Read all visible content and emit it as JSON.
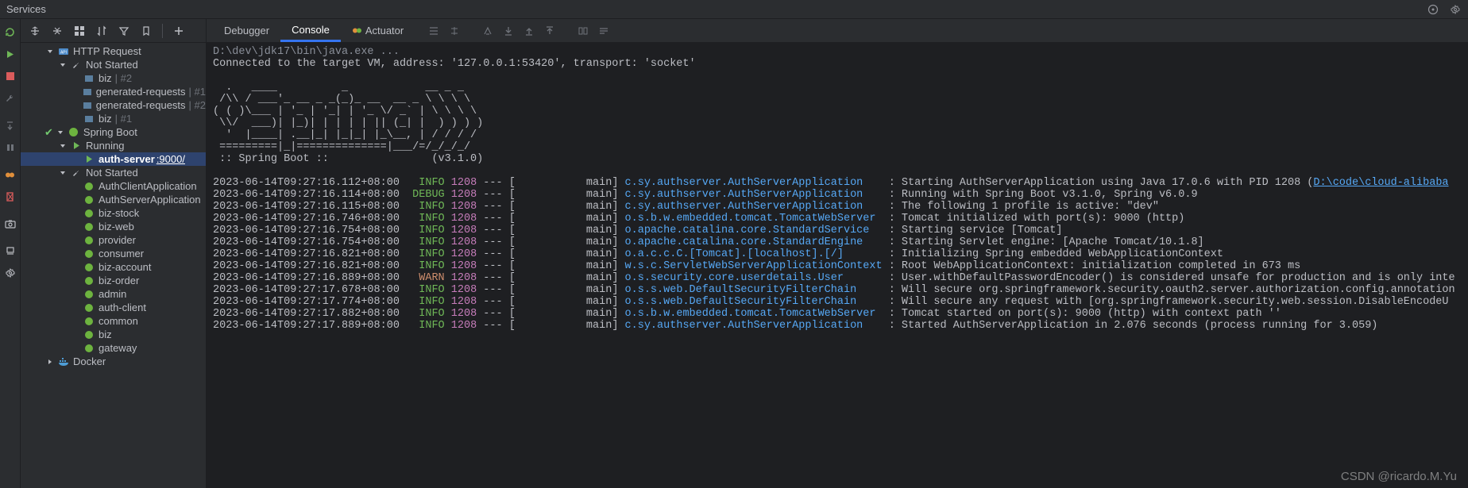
{
  "titlebar": {
    "title": "Services"
  },
  "tabs": {
    "debugger": "Debugger",
    "console": "Console",
    "actuator": "Actuator"
  },
  "tree": {
    "http_request": "HTTP Request",
    "not_started_1": "Not Started",
    "biz_2": "biz",
    "biz_2_sub": " | #2",
    "gen_req_1": "generated-requests",
    "gen_req_1_sub": " | #1",
    "gen_req_2": "generated-requests",
    "gen_req_2_sub": " | #2",
    "biz_1": "biz",
    "biz_1_sub": " | #1",
    "spring_boot": "Spring Boot",
    "running": "Running",
    "auth_server": "auth-server",
    "auth_server_port": ":9000/",
    "not_started_2": "Not Started",
    "apps": [
      "AuthClientApplication",
      "AuthServerApplication",
      "biz-stock",
      "biz-web",
      "provider",
      "consumer",
      "biz-account",
      "biz-order",
      "admin",
      "auth-client",
      "common",
      "biz",
      "gateway"
    ],
    "docker": "Docker"
  },
  "console": {
    "exe_line": "D:\\dev\\jdk17\\bin\\java.exe ...",
    "connected": "Connected to the target VM, address: '127.0.0.1:53420', transport: 'socket'",
    "banner1": "  .   ____          _            __ _ _",
    "banner2": " /\\\\ / ___'_ __ _ _(_)_ __  __ _ \\ \\ \\ \\",
    "banner3": "( ( )\\___ | '_ | '_| | '_ \\/ _` | \\ \\ \\ \\",
    "banner4": " \\\\/  ___)| |_)| | | | | || (_| |  ) ) ) )",
    "banner5": "  '  |____| .__|_| |_|_| |_\\__, | / / / /",
    "banner6": " =========|_|==============|___/=/_/_/_/",
    "banner7": " :: Spring Boot ::                (v3.1.0)",
    "logs": [
      {
        "t": "2023-06-14T09:27:16.112+08:00",
        "lvl": "INFO",
        "pid": "1208",
        "thr": "main",
        "cls": "c.sy.authserver.AuthServerApplication",
        "msg": "Starting AuthServerApplication using Java 17.0.6 with PID 1208 (",
        "link": "D:\\code\\cloud-alibaba"
      },
      {
        "t": "2023-06-14T09:27:16.114+08:00",
        "lvl": "DEBUG",
        "pid": "1208",
        "thr": "main",
        "cls": "c.sy.authserver.AuthServerApplication",
        "msg": "Running with Spring Boot v3.1.0, Spring v6.0.9"
      },
      {
        "t": "2023-06-14T09:27:16.115+08:00",
        "lvl": "INFO",
        "pid": "1208",
        "thr": "main",
        "cls": "c.sy.authserver.AuthServerApplication",
        "msg": "The following 1 profile is active: \"dev\""
      },
      {
        "t": "2023-06-14T09:27:16.746+08:00",
        "lvl": "INFO",
        "pid": "1208",
        "thr": "main",
        "cls": "o.s.b.w.embedded.tomcat.TomcatWebServer",
        "msg": "Tomcat initialized with port(s): 9000 (http)"
      },
      {
        "t": "2023-06-14T09:27:16.754+08:00",
        "lvl": "INFO",
        "pid": "1208",
        "thr": "main",
        "cls": "o.apache.catalina.core.StandardService",
        "msg": "Starting service [Tomcat]"
      },
      {
        "t": "2023-06-14T09:27:16.754+08:00",
        "lvl": "INFO",
        "pid": "1208",
        "thr": "main",
        "cls": "o.apache.catalina.core.StandardEngine",
        "msg": "Starting Servlet engine: [Apache Tomcat/10.1.8]"
      },
      {
        "t": "2023-06-14T09:27:16.821+08:00",
        "lvl": "INFO",
        "pid": "1208",
        "thr": "main",
        "cls": "o.a.c.c.C.[Tomcat].[localhost].[/]",
        "msg": "Initializing Spring embedded WebApplicationContext"
      },
      {
        "t": "2023-06-14T09:27:16.821+08:00",
        "lvl": "INFO",
        "pid": "1208",
        "thr": "main",
        "cls": "w.s.c.ServletWebServerApplicationContext",
        "msg": "Root WebApplicationContext: initialization completed in 673 ms"
      },
      {
        "t": "2023-06-14T09:27:16.889+08:00",
        "lvl": "WARN",
        "pid": "1208",
        "thr": "main",
        "cls": "o.s.security.core.userdetails.User",
        "msg": "User.withDefaultPasswordEncoder() is considered unsafe for production and is only inte"
      },
      {
        "t": "2023-06-14T09:27:17.678+08:00",
        "lvl": "INFO",
        "pid": "1208",
        "thr": "main",
        "cls": "o.s.s.web.DefaultSecurityFilterChain",
        "msg": "Will secure org.springframework.security.oauth2.server.authorization.config.annotation"
      },
      {
        "t": "2023-06-14T09:27:17.774+08:00",
        "lvl": "INFO",
        "pid": "1208",
        "thr": "main",
        "cls": "o.s.s.web.DefaultSecurityFilterChain",
        "msg": "Will secure any request with [org.springframework.security.web.session.DisableEncodeU"
      },
      {
        "t": "2023-06-14T09:27:17.882+08:00",
        "lvl": "INFO",
        "pid": "1208",
        "thr": "main",
        "cls": "o.s.b.w.embedded.tomcat.TomcatWebServer",
        "msg": "Tomcat started on port(s): 9000 (http) with context path ''"
      },
      {
        "t": "2023-06-14T09:27:17.889+08:00",
        "lvl": "INFO",
        "pid": "1208",
        "thr": "main",
        "cls": "c.sy.authserver.AuthServerApplication",
        "msg": "Started AuthServerApplication in 2.076 seconds (process running for 3.059)"
      }
    ]
  },
  "watermark": "CSDN @ricardo.M.Yu"
}
